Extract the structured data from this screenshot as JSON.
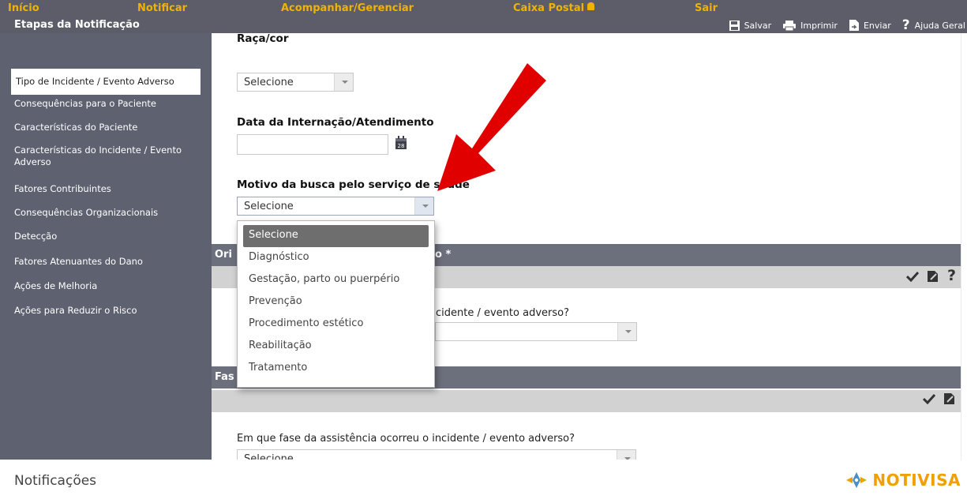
{
  "nav": {
    "items": [
      {
        "label": "Início",
        "name": "nav-inicio"
      },
      {
        "label": "Notificar",
        "name": "nav-notificar"
      },
      {
        "label": "Acompanhar/Gerenciar",
        "name": "nav-acompanhar"
      },
      {
        "label": "Caixa Postal",
        "name": "nav-caixa-postal"
      },
      {
        "label": "Sair",
        "name": "nav-sair"
      }
    ],
    "steps_title": "Etapas da Notificação"
  },
  "toolbar": {
    "save": "Salvar",
    "print": "Imprimir",
    "send": "Enviar",
    "help": "Ajuda Geral"
  },
  "sidebar": {
    "items": [
      {
        "label": "Tipo de Incidente / Evento Adverso",
        "active": true
      },
      {
        "label": "Consequências para o Paciente"
      },
      {
        "label": "Características do Paciente"
      },
      {
        "label": "Características do Incidente / Evento Adverso"
      },
      {
        "label": "Fatores Contribuintes"
      },
      {
        "label": "Consequências Organizacionais"
      },
      {
        "label": "Detecção"
      },
      {
        "label": "Fatores Atenuantes do Dano"
      },
      {
        "label": "Ações de Melhoria"
      },
      {
        "label": "Ações para Reduzir o Risco"
      }
    ]
  },
  "form": {
    "raca_label": "Raça/cor",
    "raca_value": "Selecione",
    "data_label": "Data da Internação/Atendimento",
    "data_value": "",
    "cal_day": "28",
    "motivo_label": "Motivo da busca pelo serviço de saúde",
    "motivo_value": "Selecione",
    "origin_section_prefix": "Ori",
    "origin_section_suffix": "o *",
    "origin_question_fragment": "cidente / evento adverso?",
    "origin_value": "",
    "fase_section_prefix": "Fas",
    "fase_question": "Em que fase da assistência ocorreu o incidente / evento adverso?",
    "fase_value": "Selecione"
  },
  "dropdown": {
    "options": [
      "Selecione",
      "Diagnóstico",
      "Gestação, parto ou puerpério",
      "Prevenção",
      "Procedimento estético",
      "Reabilitação",
      "Tratamento"
    ],
    "selected_index": 0
  },
  "footer": {
    "title": "Notificações",
    "brand": "NOTIVISA"
  },
  "colors": {
    "nav_bg": "#5c5d68",
    "nav_text": "#f0b400",
    "sidebar_bg": "#5e6270",
    "section_bar": "#6c6f7c",
    "section_sub": "#d2d2d2",
    "arrow_red": "#e00000",
    "brand": "#f0a000"
  }
}
